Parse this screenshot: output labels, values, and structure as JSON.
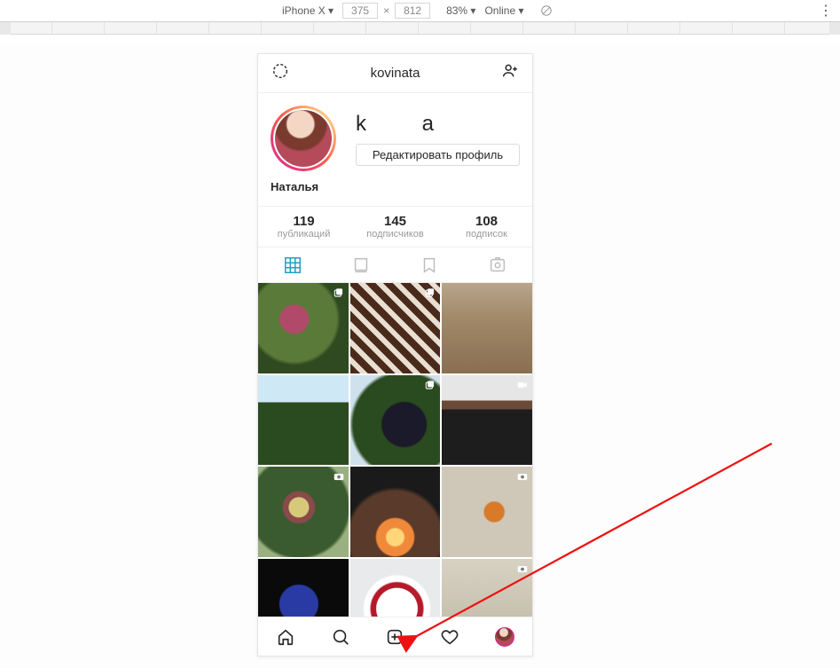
{
  "devtools": {
    "device": "iPhone X ▾",
    "width": "375",
    "height": "812",
    "zoom": "83% ▾",
    "throttle": "Online ▾"
  },
  "header": {
    "settings_icon": "settings-icon",
    "title": "kovinata",
    "discover_icon": "discover-people-icon"
  },
  "profile": {
    "username_large": "k        a",
    "edit_label": "Редактировать профиль",
    "display_name": "Наталья"
  },
  "stats": {
    "posts": {
      "count": "119",
      "label": "публикаций"
    },
    "followers": {
      "count": "145",
      "label": "подписчиков"
    },
    "following": {
      "count": "108",
      "label": "подписок"
    }
  },
  "view_tabs": {
    "grid": "grid-icon",
    "feed": "feed-icon",
    "saved": "saved-icon",
    "tagged": "tagged-icon"
  },
  "posts": [
    {
      "badge": "carousel"
    },
    {
      "badge": "carousel"
    },
    {
      "badge": null
    },
    {
      "badge": null
    },
    {
      "badge": "carousel"
    },
    {
      "badge": "video"
    },
    {
      "badge": "camera"
    },
    {
      "badge": null
    },
    {
      "badge": "camera"
    },
    {
      "badge": null
    },
    {
      "badge": null
    },
    {
      "badge": "camera"
    }
  ],
  "nav": {
    "home": "home-icon",
    "search": "search-icon",
    "add": "add-post-icon",
    "activity": "heart-icon",
    "profile": "profile-avatar"
  }
}
